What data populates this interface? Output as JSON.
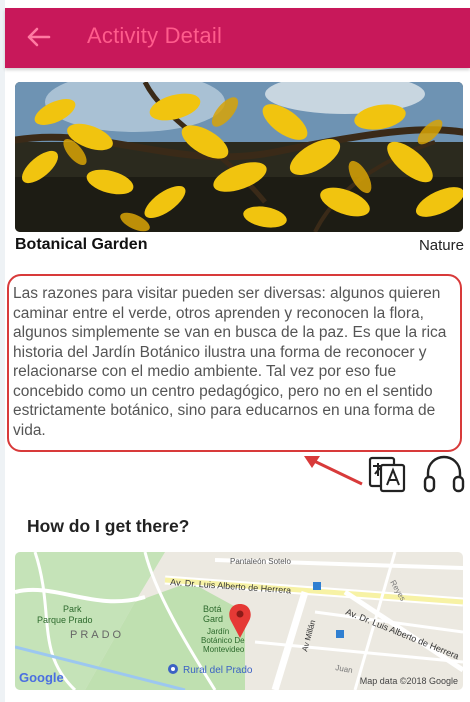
{
  "appbar": {
    "title": "Activity Detail",
    "back_icon": "arrow-left-icon",
    "color": "#c8185a",
    "title_color": "#ff5c8c"
  },
  "place": {
    "name": "Botanical Garden",
    "category": "Nature"
  },
  "description": "Las razones para visitar pueden ser diversas: algunos quieren caminar entre el verde, otros aprenden y reconocen la flora, algunos simplemente se van en busca de la paz. Es que la rica historia del Jardín Botánico ilustra una forma de reconocer y relacionarse con el medio ambiente. Tal vez por eso fue concebido como un centro pedagógico, pero no en el sentido estrictamente botánico, sino para educarnos en una forma de vida.",
  "annotation_color": "#d83a3a",
  "actions": {
    "translate_icon": "translate-icon",
    "listen_icon": "headphones-icon"
  },
  "directions": {
    "title": "How do I get there?"
  },
  "map": {
    "labels": {
      "street_top": "Pantaleón Sotelo",
      "avenue_1": "Av. Dr. Luis Alberto de Herrera",
      "avenue_2": "Av. Dr. Luis Alberto de Herrera",
      "millan": "Av Millán",
      "park": "Park",
      "parque_prado": "Parque Prado",
      "prado": "PRADO",
      "garden_1": "Botá",
      "garden_2": "Gard",
      "garden_3": "Jardín",
      "garden_4": "Botánico De",
      "garden_5": "Montevideo",
      "rural": "Rural del Prado",
      "reyes": "Reyes",
      "juan": "Juan"
    },
    "logo": "Google",
    "credit": "Map data ©2018 Google"
  }
}
